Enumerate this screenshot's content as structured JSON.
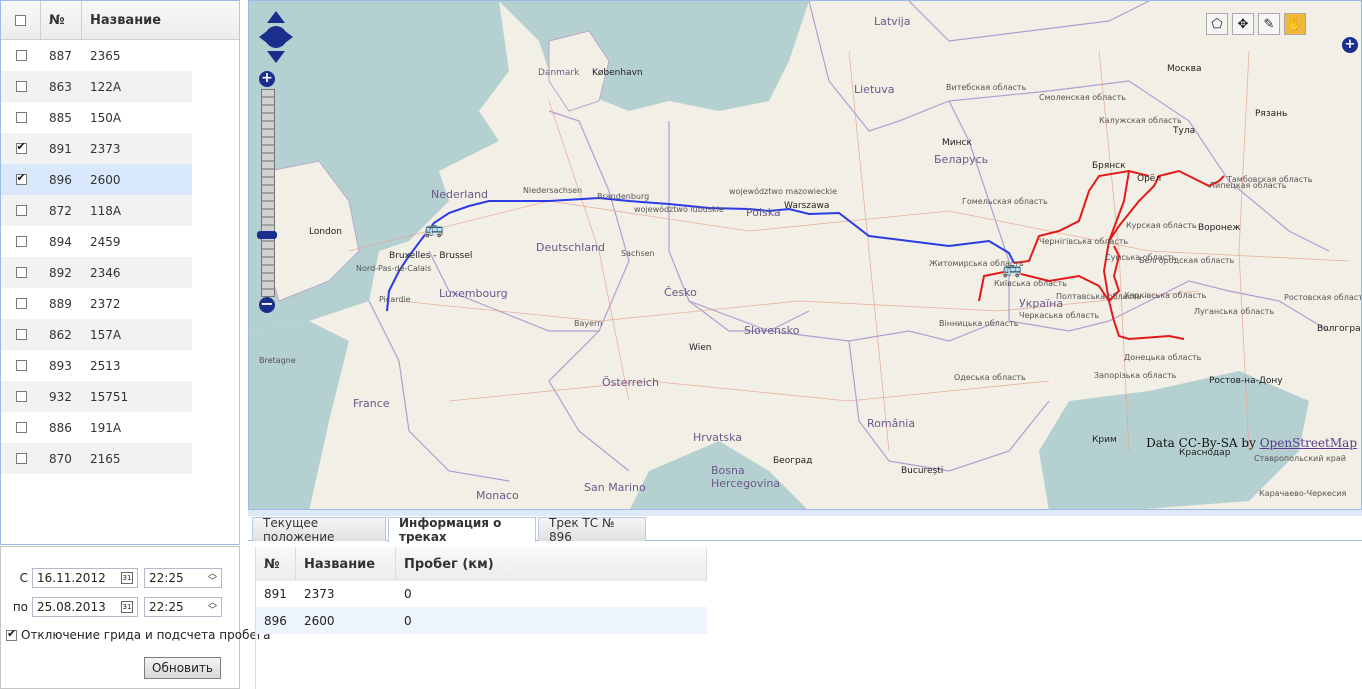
{
  "vehicle_grid": {
    "headers": {
      "num": "№",
      "name": "Название"
    },
    "rows": [
      {
        "num": "887",
        "name": "2365",
        "checked": false
      },
      {
        "num": "863",
        "name": "122А",
        "checked": false
      },
      {
        "num": "885",
        "name": "150А",
        "checked": false
      },
      {
        "num": "891",
        "name": "2373",
        "checked": true
      },
      {
        "num": "896",
        "name": "2600",
        "checked": true
      },
      {
        "num": "872",
        "name": "118А",
        "checked": false
      },
      {
        "num": "894",
        "name": "2459",
        "checked": false
      },
      {
        "num": "892",
        "name": "2346",
        "checked": false
      },
      {
        "num": "889",
        "name": "2372",
        "checked": false
      },
      {
        "num": "862",
        "name": "157А",
        "checked": false
      },
      {
        "num": "893",
        "name": "2513",
        "checked": false
      },
      {
        "num": "932",
        "name": "15751",
        "checked": false
      },
      {
        "num": "886",
        "name": "191А",
        "checked": false
      },
      {
        "num": "870",
        "name": "2165",
        "checked": false
      }
    ]
  },
  "filter": {
    "from_label": "С",
    "to_label": "по",
    "from_date": "16.11.2012",
    "from_time": "22:25",
    "to_date": "25.08.2013",
    "to_time": "22:25",
    "disable_grid_label": "Отключение грида и подсчета пробега",
    "refresh_label": "Обновить"
  },
  "map": {
    "labels": {
      "latvija": "Latvija",
      "lietuva": "Lietuva",
      "belarus": "Беларусь",
      "ukraina": "Україна",
      "deutschland": "Deutschland",
      "nederland": "Nederland",
      "luxembourg": "Luxembourg",
      "france": "France",
      "cesko": "Česko",
      "slovensko": "Slovensko",
      "osterreich": "Österreich",
      "hrvatska": "Hrvatska",
      "romania": "România",
      "bosna": "Bosna\nHercegovina",
      "monaco": "Monaco",
      "san_marino": "San Marino",
      "polska": "Polska",
      "london": "London",
      "kobenhavn": "København",
      "danmark": "Danmark",
      "warszawa": "Warszawa",
      "minsk": "Минск",
      "moskva": "Москва",
      "tula": "Тула",
      "ryazan": "Рязань",
      "bryansk": "Брянск",
      "orel": "Орёл",
      "voronezh": "Воронеж",
      "volgograd": "Волгоград",
      "rostov": "Ростов-на-Дону",
      "krasnodar": "Краснодар",
      "wien": "Wien",
      "beograd": "Београд",
      "bucuresti": "București",
      "bruxelles": "Bruxelles - Brussel",
      "krym": "Крим",
      "vitebsk": "Витебская область",
      "smolensk": "Смоленская область",
      "kaluga": "Калужская область",
      "gomel": "Гомельская область",
      "kursk": "Курская область",
      "kyiv": "Київська область",
      "zhytomyr": "Житомирська область",
      "chernihiv": "Чернігівська область",
      "sumy": "Сумська область",
      "kharkiv": "Харківська область",
      "poltava": "Полтавська область",
      "cherkasy": "Черкаська область",
      "vinnytsia": "Вінницька область",
      "donetsk": "Донецька область",
      "luhansk": "Луганська область",
      "zaporizhzhia": "Запорізька область",
      "odesa": "Одеська область",
      "belgorod": "Белгородская область",
      "lipetsk": "Липецкая область",
      "tambov": "Тамбовская область",
      "rostov_obl": "Ростовская область",
      "wojew_mazowieckie": "województwo mazowieckie",
      "wojew_lubuskie": "województwo lubuskie",
      "sachsen": "Sachsen",
      "niedersachsen": "Niedersachsen",
      "brandenburg": "Brandenburg",
      "bayern": "Bayern",
      "nord_pas": "Nord-Pas-de-Calais",
      "picardie": "Picardie",
      "bretagne": "Bretagne",
      "stavropol": "Ставропольский край",
      "karachay": "Карачаево-Черкесия"
    },
    "attribution_prefix": "Data CC-By-SA by",
    "attribution_link": "OpenStreetMap"
  },
  "tabs": [
    {
      "label": "Текущее положение",
      "active": false
    },
    {
      "label": "Информация о треках",
      "active": true
    },
    {
      "label": "Трек ТС № 896",
      "active": false
    }
  ],
  "tracks_grid": {
    "headers": {
      "num": "№",
      "name": "Название",
      "mileage": "Пробег (км)"
    },
    "rows": [
      {
        "num": "891",
        "name": "2373",
        "mileage": "0"
      },
      {
        "num": "896",
        "name": "2600",
        "mileage": "0"
      }
    ]
  },
  "colors": {
    "track_blue": "#2b3be8",
    "track_red": "#e41a1a",
    "selection": "#d9e8fb",
    "panel_border": "#99bbe8"
  }
}
